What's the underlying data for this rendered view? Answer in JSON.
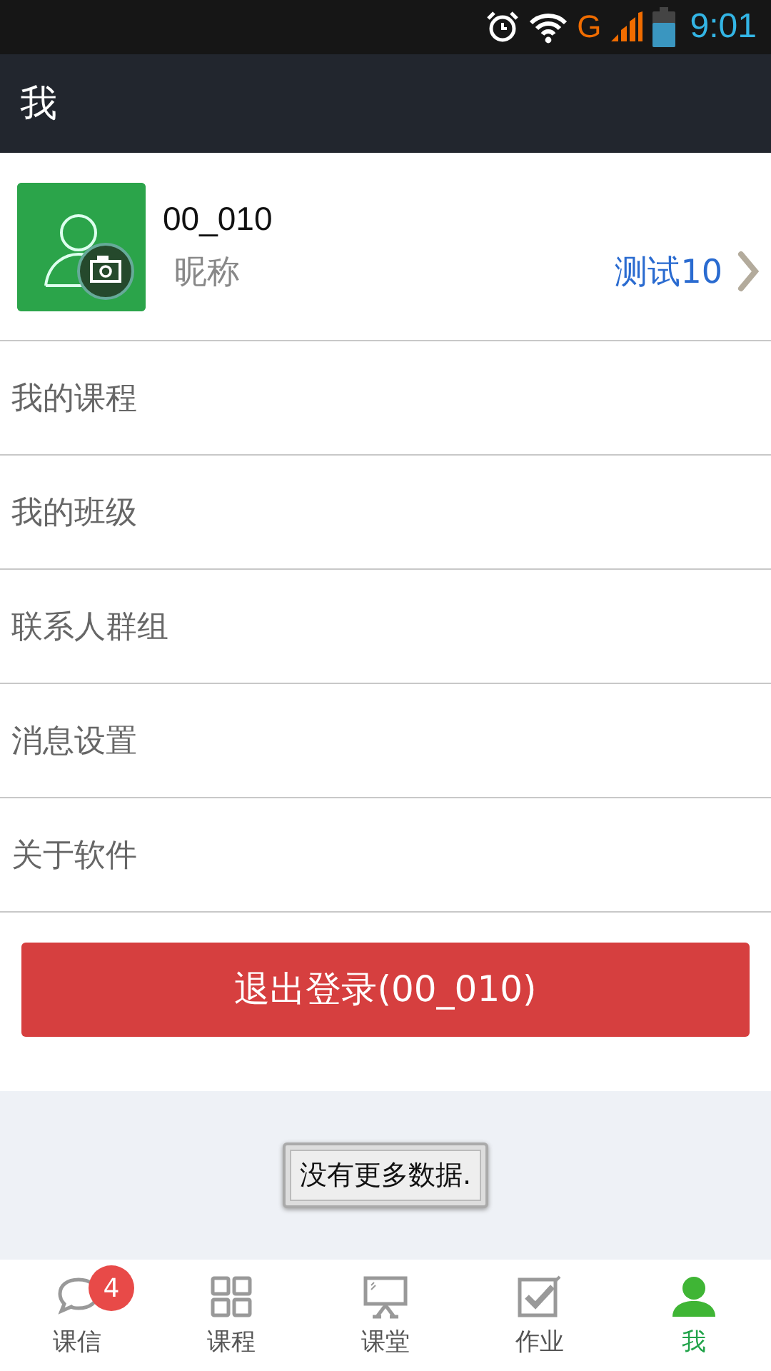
{
  "status_bar": {
    "time": "9:01",
    "network": "G"
  },
  "title_bar": {
    "title": "我"
  },
  "profile": {
    "username": "00_010",
    "nickname_label": "昵称",
    "nickname": "测试10"
  },
  "menu": [
    {
      "label": "我的课程"
    },
    {
      "label": "我的班级"
    },
    {
      "label": "联系人群组"
    },
    {
      "label": "消息设置"
    },
    {
      "label": "关于软件"
    }
  ],
  "logout_button": {
    "label": "退出登录(00_010)"
  },
  "toast": {
    "text": "没有更多数据."
  },
  "tabs": [
    {
      "label": "课信",
      "kind": "chat",
      "badge": "4",
      "selected": false
    },
    {
      "label": "课程",
      "kind": "grid",
      "selected": false
    },
    {
      "label": "课堂",
      "kind": "board",
      "selected": false
    },
    {
      "label": "作业",
      "kind": "check",
      "selected": false
    },
    {
      "label": "我",
      "kind": "person",
      "selected": true
    }
  ]
}
